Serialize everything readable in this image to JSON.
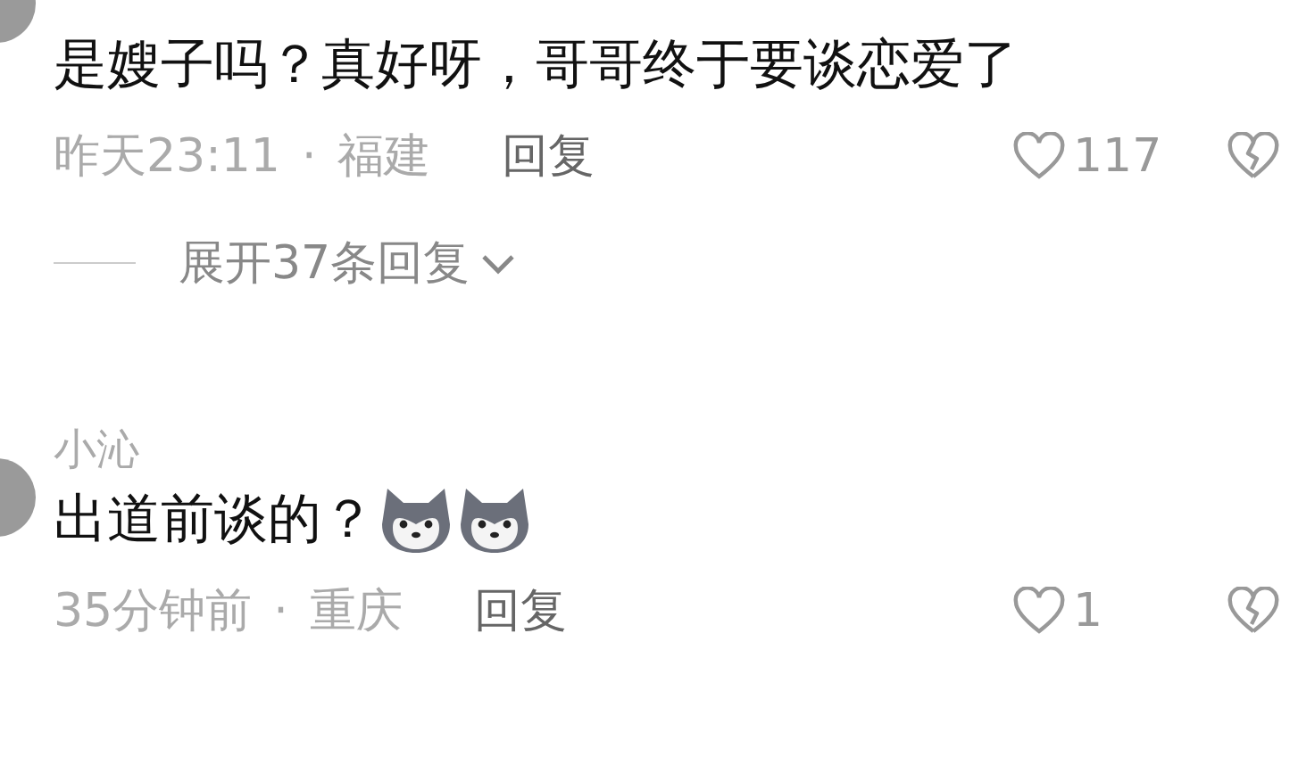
{
  "comments": [
    {
      "text": "是嫂子吗？真好呀，哥哥终于要谈恋爱了",
      "time": "昨天23:11",
      "separator": "·",
      "location": "福建",
      "reply_label": "回复",
      "likes": "117",
      "expand": {
        "label": "展开37条回复"
      }
    },
    {
      "author": "小沁",
      "text": "出道前谈的？",
      "time": "35分钟前",
      "separator": "·",
      "location": "重庆",
      "reply_label": "回复",
      "likes": "1",
      "emojis": [
        {
          "kind": "dog"
        },
        {
          "kind": "dog"
        }
      ]
    }
  ]
}
